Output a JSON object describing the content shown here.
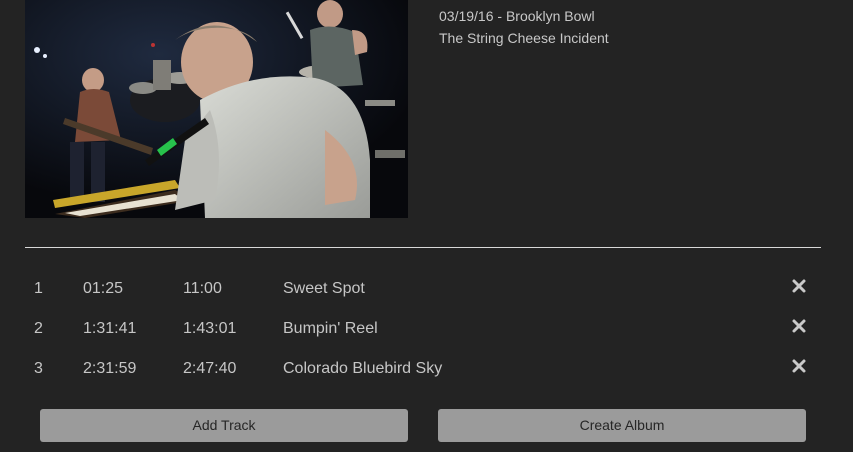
{
  "video": {
    "thumbnail": "concert-stage-keyboard-player"
  },
  "show": {
    "date_venue": "03/19/16 - Brooklyn Bowl",
    "artist": "The String Cheese Incident"
  },
  "tracks": [
    {
      "num": "1",
      "start": "01:25",
      "end": "11:00",
      "title": "Sweet Spot"
    },
    {
      "num": "2",
      "start": "1:31:41",
      "end": "1:43:01",
      "title": "Bumpin' Reel"
    },
    {
      "num": "3",
      "start": "2:31:59",
      "end": "2:47:40",
      "title": "Colorado Bluebird Sky"
    }
  ],
  "icons": {
    "remove": "close-x-icon"
  },
  "buttons": {
    "add_track": "Add Track",
    "create_album": "Create Album"
  },
  "colors": {
    "background": "#232323",
    "button": "#9b9b9b",
    "text": "#c8c8c8",
    "divider": "#d8d8d8"
  }
}
